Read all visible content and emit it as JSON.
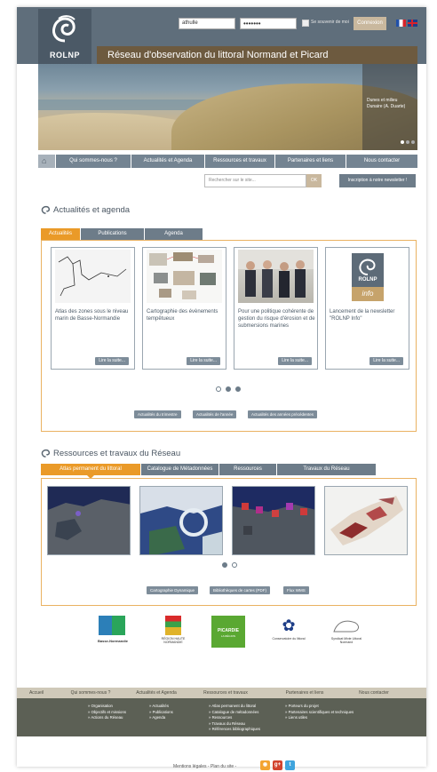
{
  "header": {
    "logo_text": "ROLNP",
    "login_user_value": "athulle",
    "login_password_value": "•••••••",
    "remember_label": "Se souvenir de moi",
    "login_button": "Connexion",
    "site_title": "Réseau d'observation du littoral Normand et Picard"
  },
  "banner": {
    "caption": "Dunes et milieu Dunaire (A. Duarte)"
  },
  "nav": {
    "home_icon": "home-icon",
    "items": [
      "Qui sommes-nous ?",
      "Actualités et Agenda",
      "Ressources et travaux",
      "Partenaires et liens",
      "Nous contacter"
    ]
  },
  "search": {
    "placeholder": "Rechercher sur le site...",
    "button": "OK",
    "newsletter_button": "Inscription à notre newsletter !"
  },
  "news": {
    "title": "Actualités et agenda",
    "tabs": [
      "Actualités",
      "Publications",
      "Agenda"
    ],
    "cards": [
      {
        "title": "Atlas des zones sous le niveau marin de Basse-Normandie",
        "button": "Lire la suite..."
      },
      {
        "title": "Cartographie des évènements tempêtueux",
        "button": "Lire la suite..."
      },
      {
        "title": "Pour une politique cohérente de gestion du risque d'érosion et de submersions marines",
        "button": "Lire la suite..."
      },
      {
        "title": "Lancement de la newsletter \"ROLNP Info\"",
        "button": "Lire la suite..."
      }
    ],
    "card4_logo": "ROLNP",
    "card4_logo_sub": "info",
    "links": [
      "Actualités du trimestre",
      "Actualités de l'année",
      "Actualités des années précédentes"
    ]
  },
  "resources": {
    "title": "Ressources et travaux du Réseau",
    "tabs": [
      "Atlas permanent du littoral",
      "Catalogue de Métadonnées",
      "Ressources",
      "Travaux du Réseau"
    ],
    "links": [
      "Cartographie Dynamique",
      "Bibliothèques de cartes (PDF)",
      "Flux WMS"
    ]
  },
  "partners": {
    "basse_normandie": "Basse-Normandie",
    "haute_normandie": "RÉGION HAUTE NORMANDIE",
    "picardie": "PICARDIE",
    "picardie_sub": "LA RÉGION",
    "conservatoire": "Conservatoire du littoral",
    "syndicat": "Syndicat Mixte Littoral Normand"
  },
  "footer": {
    "nav": [
      "Accueil",
      "Qui sommes-nous ?",
      "Actualités et Agenda",
      "Ressources et travaux",
      "Partenaires et liens",
      "Nous contacter"
    ],
    "col1": [
      "» Organisation",
      "» Objectifs et missions",
      "» Actions du Réseau"
    ],
    "col2": [
      "» Actualités",
      "» Publications",
      "» Agenda"
    ],
    "col3": [
      "» Atlas permanent du littoral",
      "» Catalogue de métadonnées",
      "» Ressources",
      "» Travaux du Réseau",
      "» Références bibliographiques"
    ],
    "col4": [
      "» Porteurs du projet",
      "» Partenaires scientifiques et techniques",
      "» Liens utiles"
    ],
    "legal": "Mentions légales",
    "sep": "-",
    "sitemap": "Plan du site",
    "social_google": "g+"
  },
  "colors": {
    "accent": "#ea9a28",
    "nav_bg": "#748492",
    "title_bar": "#6d5a3f",
    "footer_bg": "#5c6055"
  }
}
